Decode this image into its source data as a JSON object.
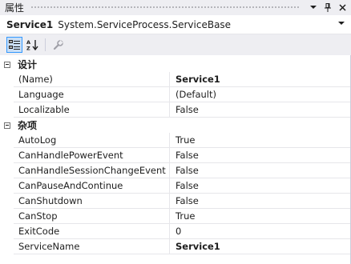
{
  "window": {
    "title": "属性",
    "title_icons": [
      "dropdown-arrow-icon",
      "pin-icon",
      "close-icon"
    ]
  },
  "selector": {
    "object_name": "Service1",
    "object_type": "System.ServiceProcess.ServiceBase"
  },
  "toolbar": {
    "buttons": [
      {
        "icon": "categorized-icon",
        "active": true
      },
      {
        "icon": "alphabetical-icon",
        "active": false
      },
      {
        "icon": "property-pages-icon",
        "active": false,
        "enabled": false
      }
    ]
  },
  "grid": {
    "categories": [
      {
        "label": "设计",
        "expanded": true,
        "properties": [
          {
            "name": "(Name)",
            "value": "Service1",
            "bold": true
          },
          {
            "name": "Language",
            "value": "(Default)",
            "bold": false
          },
          {
            "name": "Localizable",
            "value": "False",
            "bold": false
          }
        ]
      },
      {
        "label": "杂项",
        "expanded": true,
        "properties": [
          {
            "name": "AutoLog",
            "value": "True",
            "bold": false
          },
          {
            "name": "CanHandlePowerEvent",
            "value": "False",
            "bold": false
          },
          {
            "name": "CanHandleSessionChangeEvent",
            "value": "False",
            "bold": false
          },
          {
            "name": "CanPauseAndContinue",
            "value": "False",
            "bold": false
          },
          {
            "name": "CanShutdown",
            "value": "False",
            "bold": false
          },
          {
            "name": "CanStop",
            "value": "True",
            "bold": false
          },
          {
            "name": "ExitCode",
            "value": "0",
            "bold": false
          },
          {
            "name": "ServiceName",
            "value": "Service1",
            "bold": true
          }
        ]
      }
    ]
  },
  "colors": {
    "chrome_background": "#eeeef2",
    "grid_line": "#e6e6ea",
    "active_button_fill": "#c9def5",
    "active_button_border": "#3399ff"
  }
}
